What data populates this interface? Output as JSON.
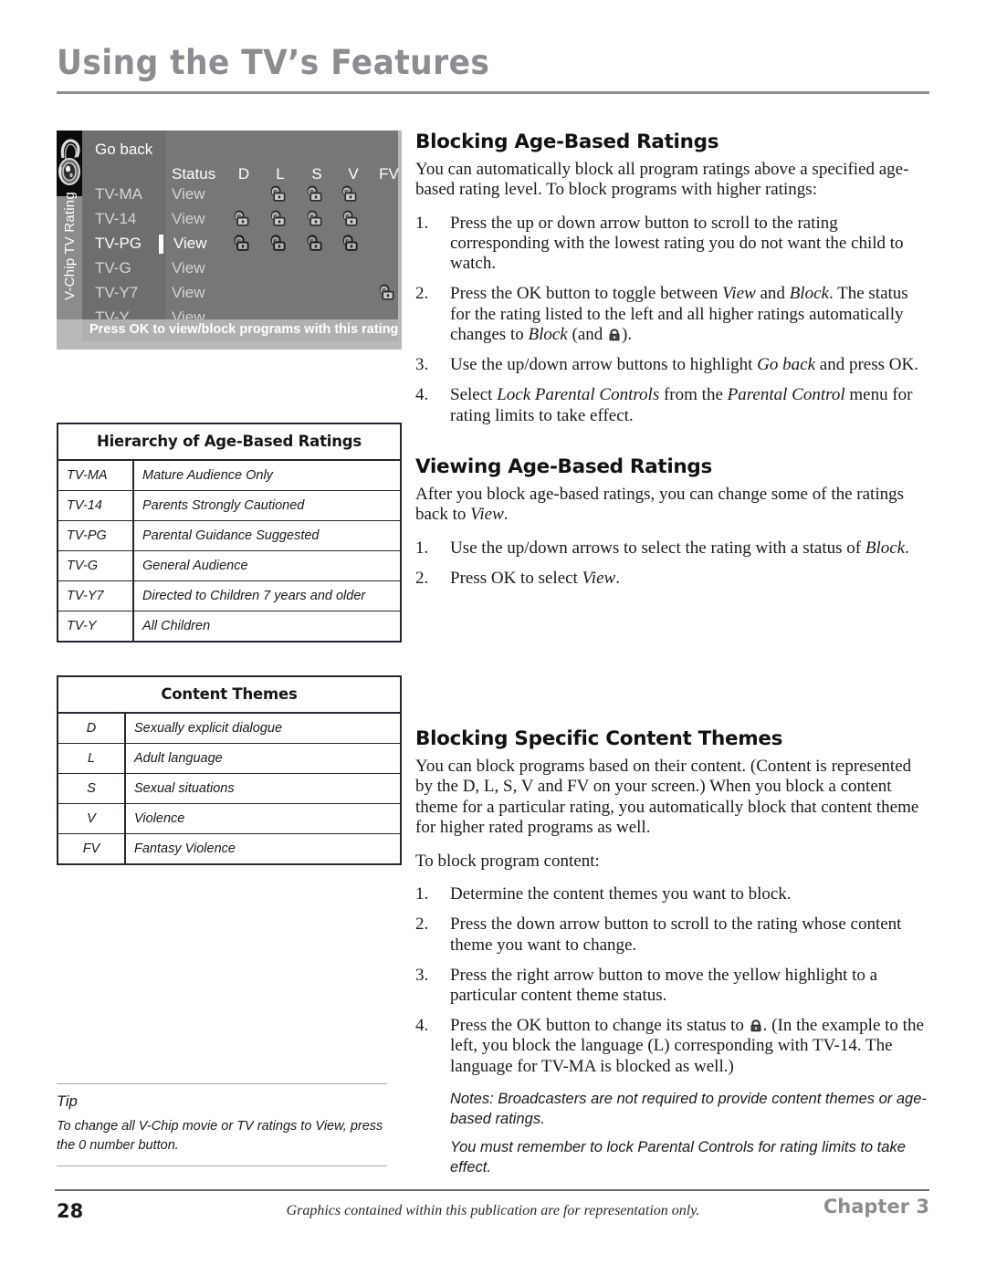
{
  "header": {
    "title": "Using the TV’s Features"
  },
  "tv_screen": {
    "sidebar_label": "V-Chip TV Rating",
    "padlock_photo_icon": "padlock-photo-icon",
    "go_back_label": "Go back",
    "column_headers": [
      "Status",
      "D",
      "L",
      "S",
      "V",
      "FV"
    ],
    "selected_row": "TV-PG",
    "rows": [
      {
        "rating": "TV-MA",
        "status": "View",
        "locks": [
          "L",
          "S",
          "V"
        ]
      },
      {
        "rating": "TV-14",
        "status": "View",
        "locks": [
          "D",
          "L",
          "S",
          "V"
        ]
      },
      {
        "rating": "TV-PG",
        "status": "View",
        "locks": [
          "D",
          "L",
          "S",
          "V"
        ]
      },
      {
        "rating": "TV-G",
        "status": "View",
        "locks": []
      },
      {
        "rating": "TV-Y7",
        "status": "View",
        "locks": [
          "FV"
        ]
      },
      {
        "rating": "TV-Y",
        "status": "View",
        "locks": []
      }
    ],
    "hint": "Press OK to view/block programs with this rating",
    "colors": {
      "bezel": "#b9b9b9",
      "sidebar": "#8c8c8c",
      "menu_left": "#6e6e6e",
      "menu_right": "#777777",
      "hint_bar": "#b0b0b0",
      "cursor": "#ffffff"
    }
  },
  "hierarchy_table": {
    "title": "Hierarchy of Age-Based Ratings",
    "rows": [
      {
        "code": "TV-MA",
        "desc": "Mature Audience Only"
      },
      {
        "code": "TV-14",
        "desc": "Parents Strongly Cautioned"
      },
      {
        "code": "TV-PG",
        "desc": "Parental Guidance Suggested"
      },
      {
        "code": "TV-G",
        "desc": "General Audience"
      },
      {
        "code": "TV-Y7",
        "desc": "Directed to Children 7 years and older"
      },
      {
        "code": "TV-Y",
        "desc": "All Children"
      }
    ]
  },
  "themes_table": {
    "title": "Content Themes",
    "rows": [
      {
        "code": "D",
        "desc": "Sexually explicit dialogue"
      },
      {
        "code": "L",
        "desc": "Adult language"
      },
      {
        "code": "S",
        "desc": "Sexual situations"
      },
      {
        "code": "V",
        "desc": "Violence"
      },
      {
        "code": "FV",
        "desc": "Fantasy Violence"
      }
    ]
  },
  "tip": {
    "title": "Tip",
    "text": "To change all V-Chip movie or TV ratings to View, press the 0 number button."
  },
  "blocking_age": {
    "heading": "Blocking Age-Based Ratings",
    "intro": "You can automatically block all program ratings above a specified age-based rating level. To block programs with higher ratings:",
    "step1": "Press the up or down arrow button to scroll to the rating corresponding with the lowest rating you do not want the child to watch.",
    "step2_a": "Press the OK button to toggle between ",
    "step2_view": "View",
    "step2_b": " and ",
    "step2_block": "Block",
    "step2_c": ". The status for the rating listed to the left and all higher ratings automatically changes to ",
    "step2_block2": "Block",
    "step2_d": " (and ",
    "step2_e": ").",
    "step3_a": "Use the up/down arrow buttons to highlight ",
    "step3_goback": "Go back",
    "step3_b": " and press OK.",
    "step4_a": "Select ",
    "step4_lock": "Lock Parental Controls",
    "step4_b": " from the ",
    "step4_menu": "Parental Control",
    "step4_c": " menu for rating limits to take effect."
  },
  "viewing_age": {
    "heading": "Viewing Age-Based Ratings",
    "intro_a": "After you block age-based ratings, you can change some of the ratings back to ",
    "intro_view": "View",
    "intro_b": ".",
    "step1_a": "Use the up/down arrows to select the rating with a status of ",
    "step1_block": "Block",
    "step1_b": ".",
    "step2_a": "Press OK to select ",
    "step2_view": "View",
    "step2_b": "."
  },
  "blocking_themes": {
    "heading": "Blocking Specific Content Themes",
    "intro": "You can block programs based on their content. (Content is represented by the D, L, S, V and FV on your screen.) When you block a content theme for a particular rating, you automatically block that content theme for higher rated programs as well.",
    "lead": "To block program content:",
    "step1": "Determine the content themes you want to block.",
    "step2": "Press the down arrow button to scroll to the rating whose content theme you want to change.",
    "step3": "Press the right arrow button to move the yellow highlight to a particular content theme status.",
    "step4_a": "Press the OK button to change its status to ",
    "step4_b": ". (In the example to the left, you block the language (L) corresponding with TV-14. The language for TV-MA is blocked as well.)",
    "note1": "Notes: Broadcasters are not required to provide content themes or age-based ratings.",
    "note2": "You must remember to lock Parental Controls for rating limits to take effect."
  },
  "footer": {
    "page_number": "28",
    "note": "Graphics contained within this publication are for representation only.",
    "chapter": "Chapter 3"
  }
}
